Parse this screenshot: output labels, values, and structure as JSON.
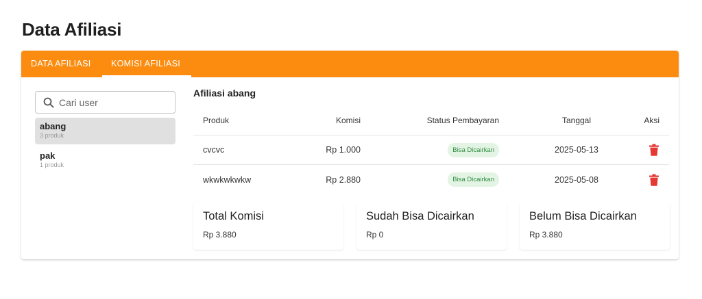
{
  "page_title": "Data Afiliasi",
  "tabs": [
    {
      "label": "DATA AFILIASI",
      "active": false
    },
    {
      "label": "KOMISI AFILIASI",
      "active": true
    }
  ],
  "colors": {
    "accent": "#fb8c0f",
    "badge_bg": "#e3f4e5",
    "badge_text": "#2e8b3e",
    "delete": "#e53935"
  },
  "search": {
    "placeholder": "Cari user",
    "value": "",
    "icon": "search-icon"
  },
  "users": [
    {
      "name": "abang",
      "count": "3 produk",
      "selected": true
    },
    {
      "name": "pak",
      "count": "1 produk",
      "selected": false
    }
  ],
  "section_title": "Afiliasi abang",
  "table": {
    "headers": {
      "produk": "Produk",
      "komisi": "Komisi",
      "status": "Status Pembayaran",
      "tanggal": "Tanggal",
      "aksi": "Aksi"
    },
    "rows": [
      {
        "produk": "cvcvc",
        "komisi": "Rp 1.000",
        "status": "Bisa Dicairkan",
        "tanggal": "2025-05-13",
        "aksi_icon": "trash-icon"
      },
      {
        "produk": "wkwkwkwkw",
        "komisi": "Rp 2.880",
        "status": "Bisa Dicairkan",
        "tanggal": "2025-05-08",
        "aksi_icon": "trash-icon"
      }
    ]
  },
  "summary": [
    {
      "title": "Total Komisi",
      "value": "Rp 3.880"
    },
    {
      "title": "Sudah Bisa Dicairkan",
      "value": "Rp 0"
    },
    {
      "title": "Belum Bisa Dicairkan",
      "value": "Rp 3.880"
    }
  ]
}
